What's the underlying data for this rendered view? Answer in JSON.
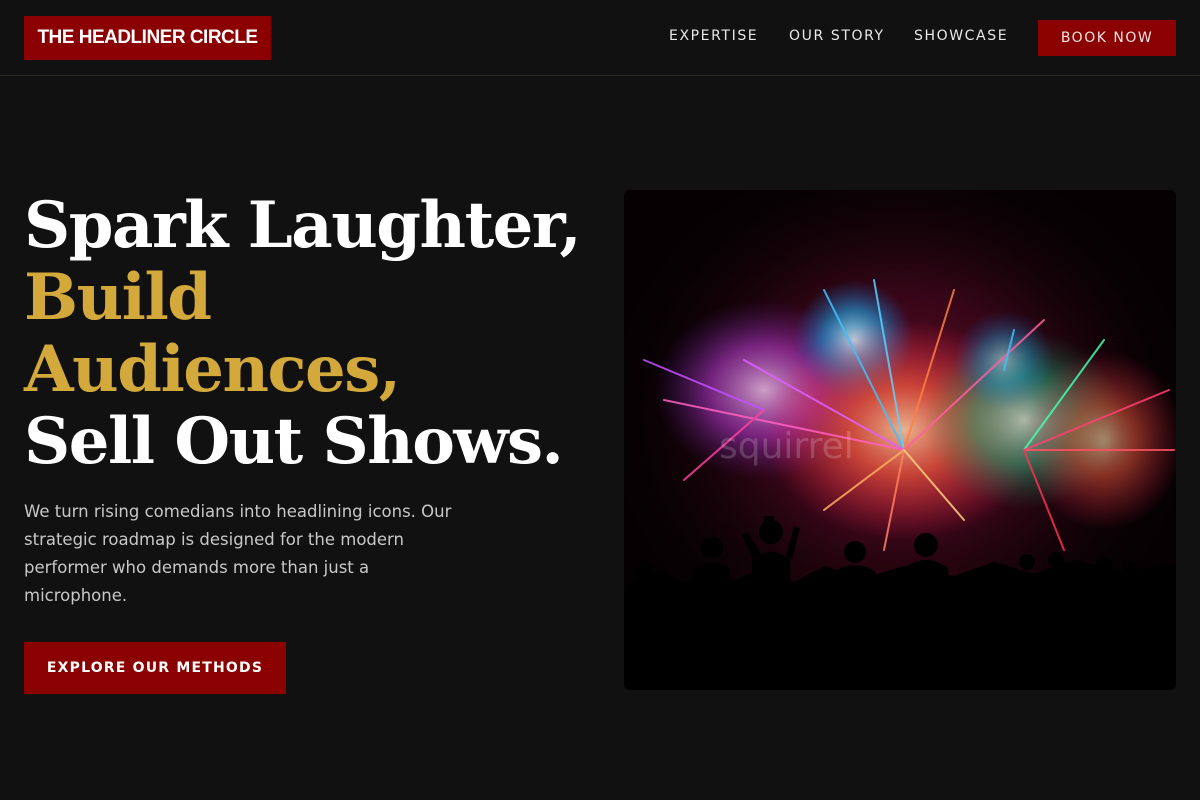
{
  "header": {
    "logo_text": "THE HEADLINER CIRCLE",
    "nav": [
      {
        "label": "EXPERTISE"
      },
      {
        "label": "OUR STORY"
      },
      {
        "label": "SHOWCASE"
      }
    ],
    "cta_label": "BOOK NOW"
  },
  "hero": {
    "headline": {
      "line1": "Spark Laughter,",
      "line2": "Build",
      "line3": "Audiences,",
      "line4": "Sell Out Shows."
    },
    "description": "We turn rising comedians into headlining icons. Our strategic roadmap is designed for the modern performer who demands more than just a microphone.",
    "cta_label": "EXPLORE OUR METHODS",
    "image": {
      "subject": "fireworks-over-crowd-photo",
      "watermark": "squirrel"
    }
  },
  "colors": {
    "background": "#111111",
    "accent_red": "#8b0000",
    "accent_gold": "#d4a93c",
    "text_primary": "#ffffff",
    "text_secondary": "#c8c8c8"
  }
}
